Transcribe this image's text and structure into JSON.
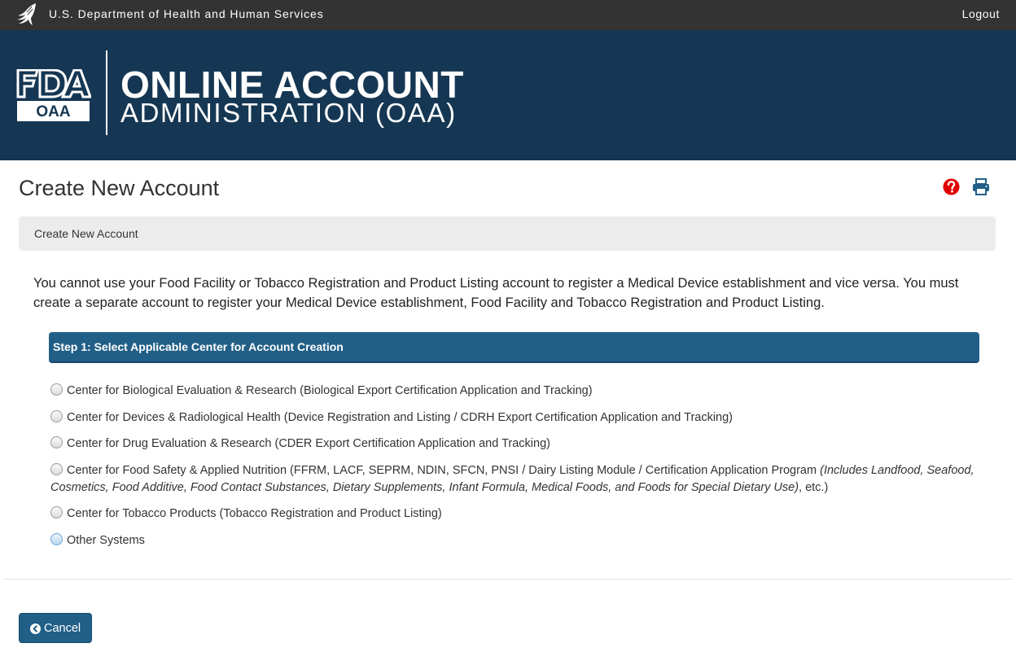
{
  "topbar": {
    "agency": "U.S. Department of Health and Human Services",
    "logout": "Logout"
  },
  "banner": {
    "logo_fda": "FDA",
    "logo_oaa": "OAA",
    "title_line1": "ONLINE ACCOUNT",
    "title_line2": "ADMINISTRATION (OAA)"
  },
  "page": {
    "title": "Create New Account",
    "breadcrumb": "Create New Account",
    "notice": "You cannot use your Food Facility or Tobacco Registration and Product Listing account to register a Medical Device establishment and vice versa. You must create a separate account to register your Medical Device establishment, Food Facility and Tobacco Registration and Product Listing."
  },
  "step1": {
    "header": "Step 1: Select Applicable Center for Account Creation",
    "options": [
      {
        "label": "Center for Biological Evaluation & Research (Biological Export Certification Application and Tracking)"
      },
      {
        "label": "Center for Devices & Radiological Health (Device Registration and Listing / CDRH Export Certification Application and Tracking)"
      },
      {
        "label": "Center for Drug Evaluation & Research (CDER Export Certification Application and Tracking)"
      },
      {
        "label": "Center for Food Safety & Applied Nutrition (FFRM, LACF, SEPRM, NDIN, SFCN, PNSI / Dairy Listing Module / Certification Application Program ",
        "italic": "(Includes Landfood, Seafood, Cosmetics, Food Additive, Food Contact Substances, Dietary Supplements, Infant Formula, Medical Foods, and Foods for Special Dietary Use)",
        "suffix": ", etc.)"
      },
      {
        "label": "Center for Tobacco Products (Tobacco Registration and Product Listing)"
      },
      {
        "label": "Other Systems"
      }
    ]
  },
  "buttons": {
    "cancel": "Cancel"
  },
  "icons": {
    "help": "question-circle-icon",
    "print": "print-icon",
    "cancel": "chevron-circle-left-icon"
  },
  "colors": {
    "topbar": "#333333",
    "banner": "#153753",
    "accent": "#215f87",
    "help": "#e00000"
  }
}
